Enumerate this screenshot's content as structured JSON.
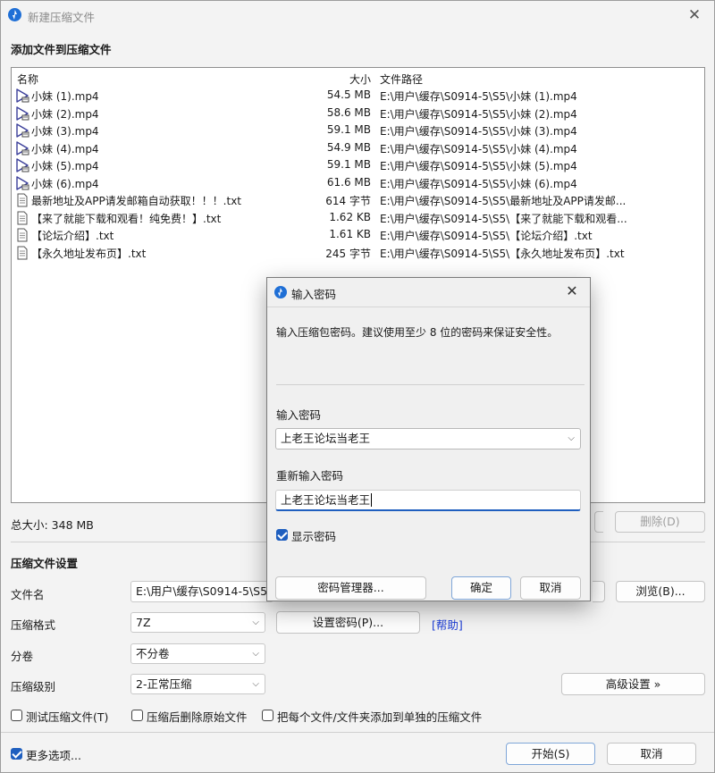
{
  "window": {
    "title": "新建压缩文件"
  },
  "add_section": {
    "heading": "添加文件到压缩文件"
  },
  "file_list": {
    "columns": {
      "name": "名称",
      "size": "大小",
      "path": "文件路径"
    },
    "rows": [
      {
        "name": "小妹 (1).mp4",
        "size": "54.5 MB",
        "path": "E:\\用户\\缓存\\S0914-5\\S5\\小妹 (1).mp4",
        "icon": "video-file-icon"
      },
      {
        "name": "小妹 (2).mp4",
        "size": "58.6 MB",
        "path": "E:\\用户\\缓存\\S0914-5\\S5\\小妹 (2).mp4",
        "icon": "video-file-icon"
      },
      {
        "name": "小妹 (3).mp4",
        "size": "59.1 MB",
        "path": "E:\\用户\\缓存\\S0914-5\\S5\\小妹 (3).mp4",
        "icon": "video-file-icon"
      },
      {
        "name": "小妹 (4).mp4",
        "size": "54.9 MB",
        "path": "E:\\用户\\缓存\\S0914-5\\S5\\小妹 (4).mp4",
        "icon": "video-file-icon"
      },
      {
        "name": "小妹 (5).mp4",
        "size": "59.1 MB",
        "path": "E:\\用户\\缓存\\S0914-5\\S5\\小妹 (5).mp4",
        "icon": "video-file-icon"
      },
      {
        "name": "小妹 (6).mp4",
        "size": "61.6 MB",
        "path": "E:\\用户\\缓存\\S0914-5\\S5\\小妹 (6).mp4",
        "icon": "video-file-icon"
      },
      {
        "name": "最新地址及APP请发邮箱自动获取！！！.txt",
        "size": "614 字节",
        "path": "E:\\用户\\缓存\\S0914-5\\S5\\最新地址及APP请发邮...",
        "icon": "text-file-icon"
      },
      {
        "name": "【来了就能下载和观看！纯免费！】.txt",
        "size": "1.62 KB",
        "path": "E:\\用户\\缓存\\S0914-5\\S5\\【来了就能下载和观看...",
        "icon": "text-file-icon"
      },
      {
        "name": "【论坛介绍】.txt",
        "size": "1.61 KB",
        "path": "E:\\用户\\缓存\\S0914-5\\S5\\【论坛介绍】.txt",
        "icon": "text-file-icon"
      },
      {
        "name": "【永久地址发布页】.txt",
        "size": "245 字节",
        "path": "E:\\用户\\缓存\\S0914-5\\S5\\【永久地址发布页】.txt",
        "icon": "text-file-icon"
      }
    ]
  },
  "total": {
    "label": "总大小: 348 MB"
  },
  "delete_button": "删除(D)",
  "settings": {
    "heading": "压缩文件设置",
    "filename_label": "文件名",
    "filename_value": "E:\\用户\\缓存\\S0914-5\\S5\\",
    "browse_button": "浏览(B)...",
    "format_label": "压缩格式",
    "format_value": "7Z",
    "set_password_button": "设置密码(P)...",
    "help_link": "[帮助]",
    "split_label": "分卷",
    "split_value": "不分卷",
    "level_label": "压缩级别",
    "level_value": "2-正常压缩",
    "advanced_button": "高级设置 »",
    "opt_test": "测试压缩文件(T)",
    "opt_delete": "压缩后删除原始文件",
    "opt_separate": "把每个文件/文件夹添加到单独的压缩文件",
    "opt_test_checked": false,
    "opt_delete_checked": false,
    "opt_separate_checked": false
  },
  "footer": {
    "more_options": "更多选项...",
    "more_options_checked": true,
    "start_button": "开始(S)",
    "cancel_button": "取消"
  },
  "password_dialog": {
    "title": "输入密码",
    "description": "输入压缩包密码。建议使用至少 8 位的密码来保证安全性。",
    "enter_label": "输入密码",
    "enter_value": "上老王论坛当老王",
    "reenter_label": "重新输入密码",
    "reenter_value": "上老王论坛当老王",
    "show_password": "显示密码",
    "show_password_checked": true,
    "manager_button": "密码管理器...",
    "ok_button": "确定",
    "cancel_button": "取消"
  }
}
